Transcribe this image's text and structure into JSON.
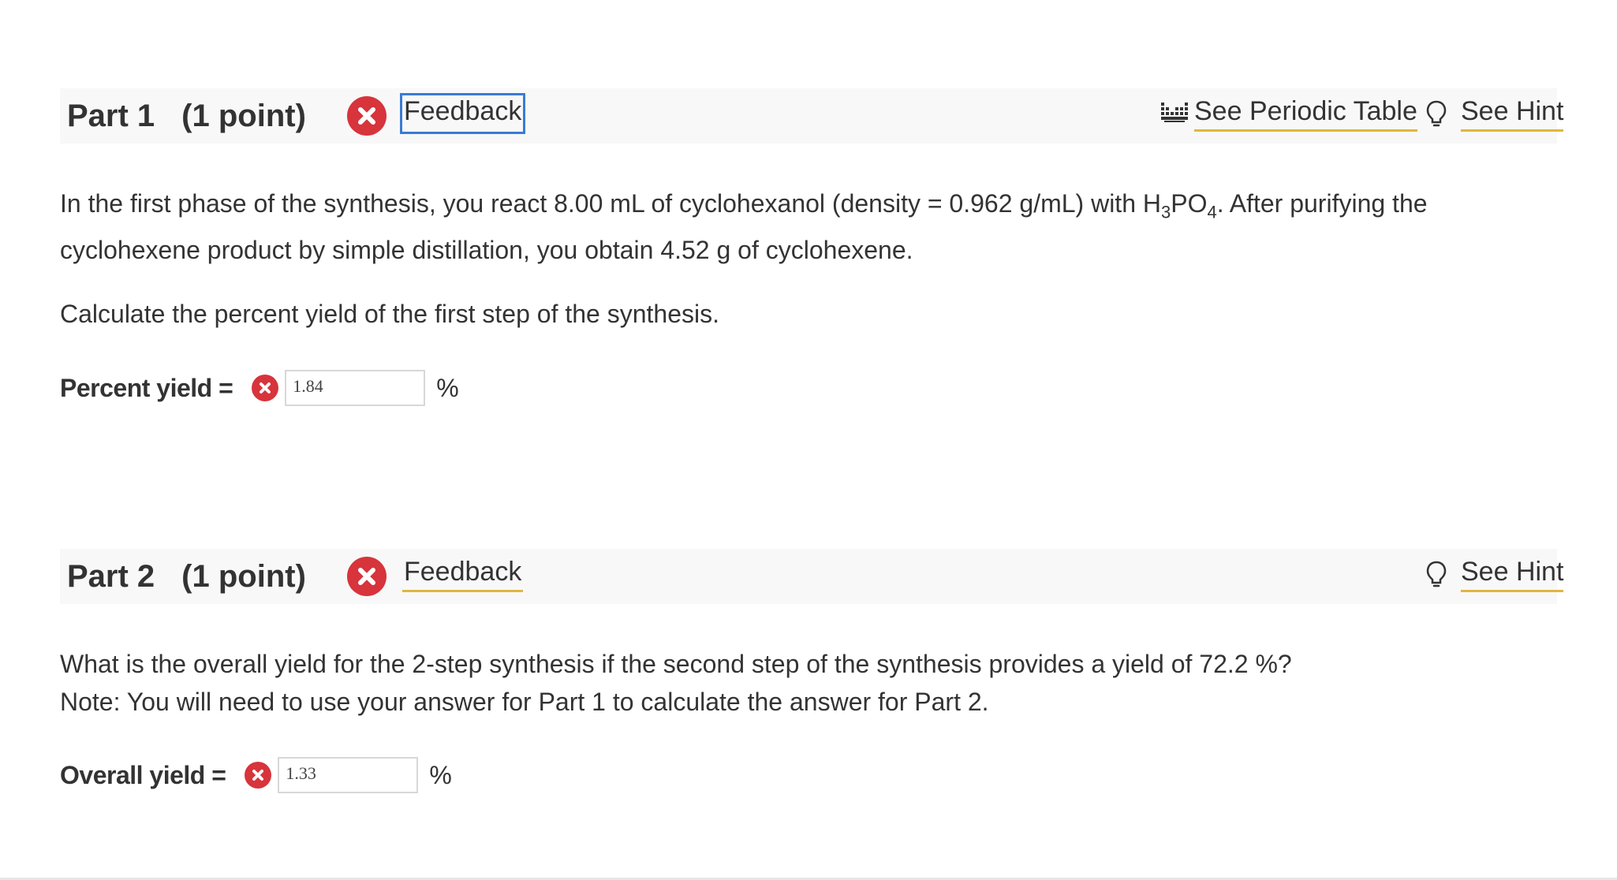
{
  "part1": {
    "title": "Part 1",
    "points": "(1 point)",
    "status_icon": "x-circle-icon",
    "feedback_label": "Feedback",
    "periodic_table_label": "See Periodic Table",
    "hint_label": "See Hint",
    "question": {
      "line1_before_formula": "In the first phase of the synthesis, you react 8.00 mL of cyclohexanol (density = 0.962 g/mL) with H",
      "formula_sub1": "3",
      "formula_mid": "PO",
      "formula_sub2": "4",
      "line1_after_formula": ". After purifying the",
      "line2": "cyclohexene product by simple distillation, you obtain 4.52 g of cyclohexene.",
      "prompt": "Calculate the percent yield of the first step of the synthesis."
    },
    "answer": {
      "label": "Percent yield =",
      "value": "1.84",
      "unit": "%"
    }
  },
  "part2": {
    "title": "Part 2",
    "points": "(1 point)",
    "status_icon": "x-circle-icon",
    "feedback_label": "Feedback",
    "hint_label": "See Hint",
    "question": {
      "line1": "What is the overall yield for the 2-step synthesis if the second step of the synthesis provides a yield of 72.2 %?",
      "line2": "Note: You will need to use your answer for Part 1 to calculate the answer for Part 2."
    },
    "answer": {
      "label": "Overall yield =",
      "value": "1.33",
      "unit": "%"
    }
  },
  "colors": {
    "error_red": "#d7343c",
    "link_underline": "#e0b640",
    "focus_outline": "#3a7bd5",
    "header_bg": "#f8f8f8"
  }
}
